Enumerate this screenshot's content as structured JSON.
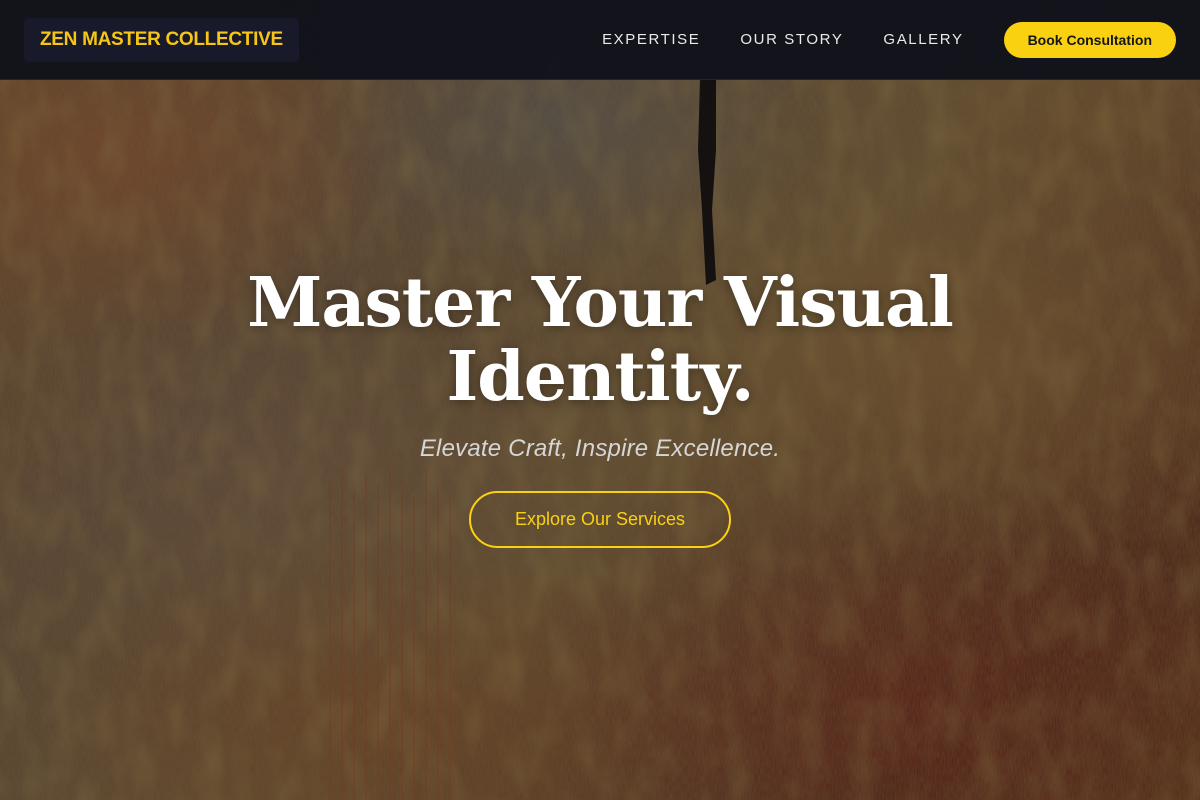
{
  "nav": {
    "brand": "ZEN MASTER COLLECTIVE",
    "links": [
      "EXPERTISE",
      "OUR STORY",
      "GALLERY"
    ],
    "cta_label": "Book Consultation"
  },
  "hero": {
    "title_line1": "Master Your Visual",
    "title_line2": "Identity.",
    "subtitle": "Elevate Craft, Inspire Excellence.",
    "button_label": "Explore Our Services",
    "background": "textured-oil-painting-background"
  },
  "colors": {
    "accent": "#fad111",
    "nav_background": "#0e101a",
    "title_text": "#ffffff"
  }
}
